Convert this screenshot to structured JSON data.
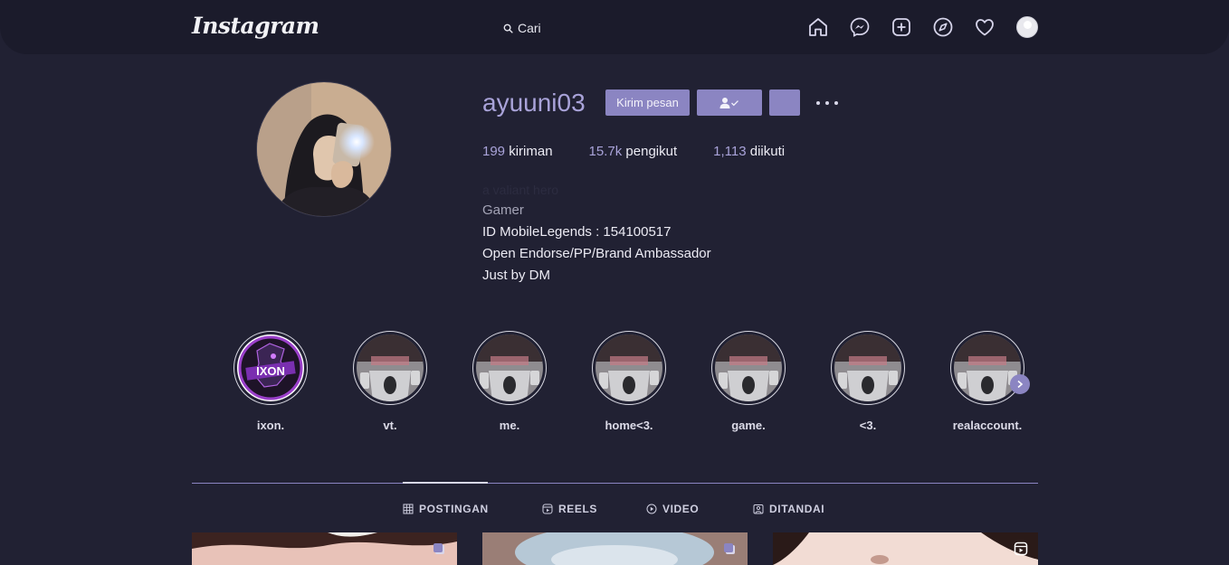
{
  "header": {
    "logo": "Instagram",
    "search_placeholder": "Cari",
    "nav_icons": [
      "home-icon",
      "messenger-icon",
      "new-post-icon",
      "explore-icon",
      "activity-heart-icon",
      "profile-avatar"
    ]
  },
  "profile": {
    "username": "ayuuni03",
    "buttons": {
      "message": "Kirim pesan",
      "following_icon": "person-check-icon",
      "suggest_icon": "chevron-down-icon",
      "more_icon": "more-dots-icon"
    },
    "stats": [
      {
        "value": "199",
        "label": "kiriman"
      },
      {
        "value": "15.7k",
        "label": "pengikut"
      },
      {
        "value": "1,113",
        "label": "diikuti"
      }
    ],
    "full_name": "a valiant hero",
    "category": "Gamer",
    "bio": [
      "ID MobileLegends : 154100517",
      "Open Endorse/PP/Brand Ambassador",
      "Just by DM"
    ]
  },
  "highlights": [
    {
      "label": "ixon."
    },
    {
      "label": "vt."
    },
    {
      "label": "me."
    },
    {
      "label": "home<3."
    },
    {
      "label": "game."
    },
    {
      "label": "<3."
    },
    {
      "label": "realaccount."
    }
  ],
  "highlight_logo_text": "IXON",
  "tabs": [
    {
      "label": "POSTINGAN",
      "icon": "grid-icon",
      "active": true
    },
    {
      "label": "REELS",
      "icon": "reels-icon",
      "active": false
    },
    {
      "label": "VIDEO",
      "icon": "video-play-icon",
      "active": false
    },
    {
      "label": "DITANDAI",
      "icon": "tagged-icon",
      "active": false
    }
  ],
  "posts": [
    {
      "badge_icon": "multiple-posts-icon"
    },
    {
      "badge_icon": "multiple-posts-icon"
    },
    {
      "badge_icon": "reels-icon"
    }
  ],
  "colors": {
    "background": "#212133",
    "header": "#1b1b2b",
    "accent": "#8b85c2",
    "username": "#a9a3d9"
  }
}
